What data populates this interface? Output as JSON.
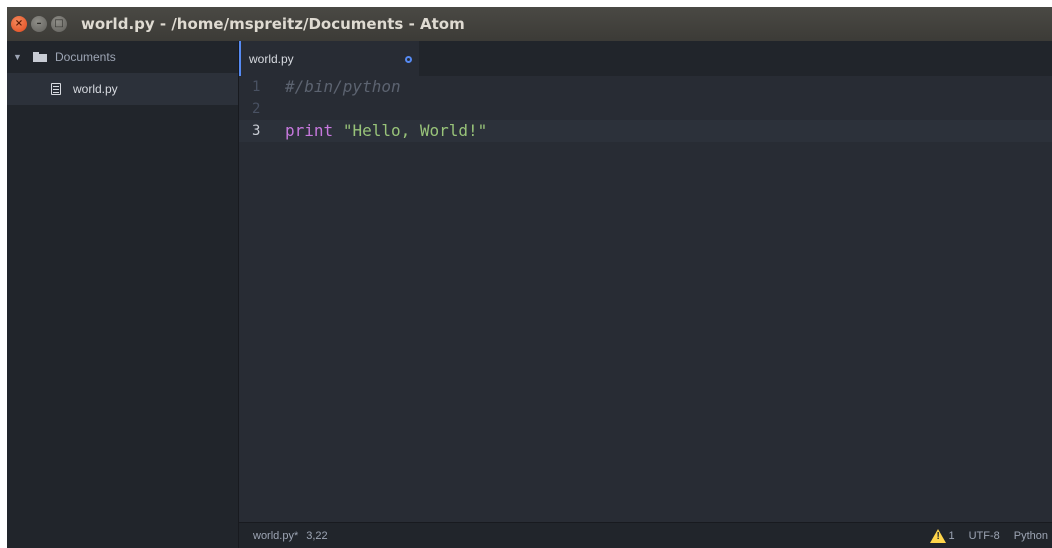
{
  "window": {
    "title": "world.py - /home/mspreitz/Documents - Atom",
    "close_glyph": "×",
    "min_glyph": "–",
    "max_glyph": "□"
  },
  "tree": {
    "root_label": "Documents",
    "files": [
      {
        "label": "world.py"
      }
    ]
  },
  "tabs": [
    {
      "label": "world.py",
      "modified": true
    }
  ],
  "editor": {
    "lines": [
      {
        "number": "1",
        "comment": "#/bin/python"
      },
      {
        "number": "2"
      },
      {
        "number": "3",
        "keyword": "print",
        "string": "\"Hello, World!\""
      }
    ]
  },
  "status": {
    "file": "world.py*",
    "cursor": "3,22",
    "warnings": "1",
    "encoding": "UTF-8",
    "grammar": "Python"
  },
  "colors": {
    "accent": "#568af2",
    "keyword": "#c678dd",
    "string": "#98c379",
    "comment": "#5c6370",
    "warning": "#ffd54a"
  }
}
